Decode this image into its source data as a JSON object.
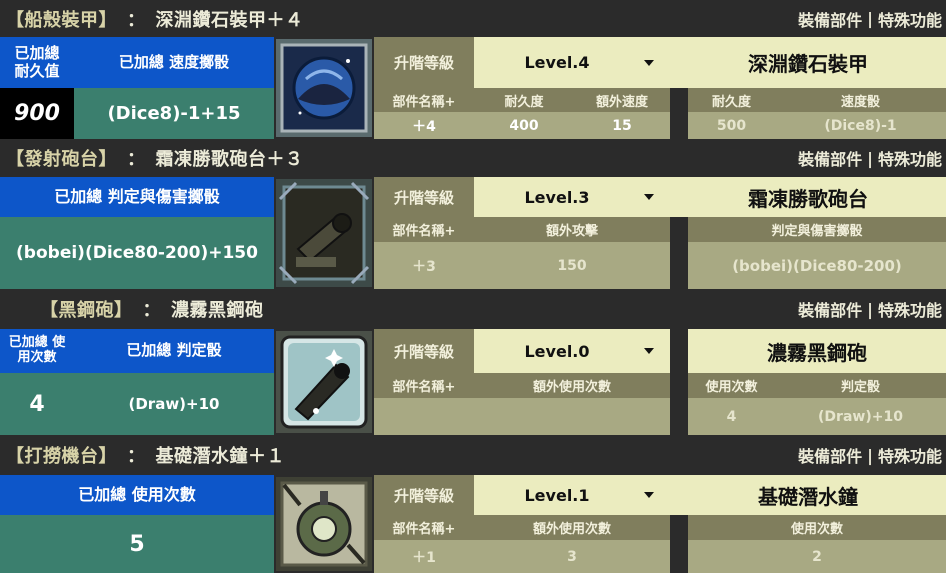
{
  "header_links": {
    "equip": "裝備部件",
    "sep": "|",
    "special": "特殊功能"
  },
  "upgrade_label": "升階等級",
  "sections": [
    {
      "category": "【船殼裝甲】",
      "colon": "：",
      "item_title": "深淵鑽石裝甲＋４",
      "stat_a_label": "已加總 耐久值",
      "stat_b_label": "已加總  速度擲骰",
      "stat_a_value": "900",
      "stat_b_value": "(Dice8)-1+15",
      "level": "Level.4",
      "item_name": "深淵鑽石裝甲",
      "col_labels": [
        "部件名稱+",
        "耐久度",
        "額外速度"
      ],
      "col_values": [
        "＋4",
        "400",
        "15"
      ],
      "base_labels": [
        "耐久度",
        "速度骰"
      ],
      "base_values": [
        "500",
        "(Dice8)-1"
      ],
      "icon": "abyss-diamond-armor-icon"
    },
    {
      "category": "【發射砲台】",
      "colon": "：",
      "item_title": "霜凍勝歌砲台＋３",
      "stat_label": "已加總  判定與傷害擲骰",
      "stat_value": "(bobei)(Dice80-200)+150",
      "level": "Level.3",
      "item_name": "霜凍勝歌砲台",
      "col_labels": [
        "部件名稱+",
        "額外攻擊"
      ],
      "col_values": [
        "＋3",
        "150"
      ],
      "base_labels": [
        "判定與傷害擲骰"
      ],
      "base_values": [
        "(bobei)(Dice80-200)"
      ],
      "icon": "frost-cannon-icon"
    },
    {
      "category": "【黑鋼砲】",
      "colon": "：",
      "item_title": "濃霧黑鋼砲",
      "stat_a_label": "已加總 使用次數",
      "stat_b_label": "已加總    判定骰",
      "stat_a_value": "4",
      "stat_b_value": "(Draw)+10",
      "level": "Level.0",
      "item_name": "濃霧黑鋼砲",
      "col_labels": [
        "部件名稱+",
        "額外使用次數"
      ],
      "col_values": [
        "",
        ""
      ],
      "base_labels": [
        "使用次數",
        "判定骰"
      ],
      "base_values": [
        "4",
        "(Draw)+10"
      ],
      "icon": "black-steel-gun-icon"
    },
    {
      "category": "【打撈機台】",
      "colon": "：",
      "item_title": "基礎潛水鐘＋１",
      "stat_label": "已加總  使用次數",
      "stat_value": "5",
      "level": "Level.1",
      "item_name": "基礎潛水鐘",
      "col_labels": [
        "部件名稱+",
        "額外使用次數"
      ],
      "col_values": [
        "＋1",
        "3"
      ],
      "base_labels": [
        "使用次數"
      ],
      "base_values": [
        "2"
      ],
      "icon": "diving-bell-icon"
    }
  ]
}
